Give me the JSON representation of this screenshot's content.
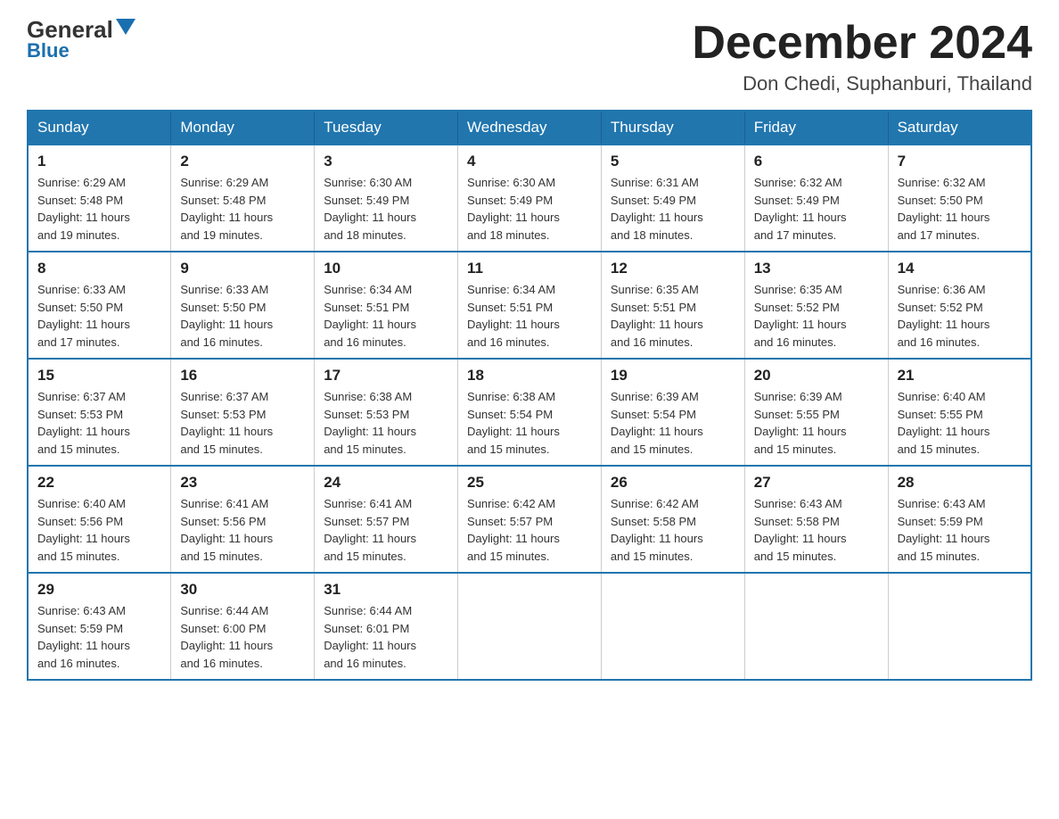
{
  "logo": {
    "general": "General",
    "triangle_char": "▲",
    "blue": "Blue"
  },
  "title": "December 2024",
  "subtitle": "Don Chedi, Suphanburi, Thailand",
  "days_of_week": [
    "Sunday",
    "Monday",
    "Tuesday",
    "Wednesday",
    "Thursday",
    "Friday",
    "Saturday"
  ],
  "weeks": [
    [
      {
        "day": 1,
        "sunrise": "6:29 AM",
        "sunset": "5:48 PM",
        "daylight": "11 hours and 19 minutes."
      },
      {
        "day": 2,
        "sunrise": "6:29 AM",
        "sunset": "5:48 PM",
        "daylight": "11 hours and 19 minutes."
      },
      {
        "day": 3,
        "sunrise": "6:30 AM",
        "sunset": "5:49 PM",
        "daylight": "11 hours and 18 minutes."
      },
      {
        "day": 4,
        "sunrise": "6:30 AM",
        "sunset": "5:49 PM",
        "daylight": "11 hours and 18 minutes."
      },
      {
        "day": 5,
        "sunrise": "6:31 AM",
        "sunset": "5:49 PM",
        "daylight": "11 hours and 18 minutes."
      },
      {
        "day": 6,
        "sunrise": "6:32 AM",
        "sunset": "5:49 PM",
        "daylight": "11 hours and 17 minutes."
      },
      {
        "day": 7,
        "sunrise": "6:32 AM",
        "sunset": "5:50 PM",
        "daylight": "11 hours and 17 minutes."
      }
    ],
    [
      {
        "day": 8,
        "sunrise": "6:33 AM",
        "sunset": "5:50 PM",
        "daylight": "11 hours and 17 minutes."
      },
      {
        "day": 9,
        "sunrise": "6:33 AM",
        "sunset": "5:50 PM",
        "daylight": "11 hours and 16 minutes."
      },
      {
        "day": 10,
        "sunrise": "6:34 AM",
        "sunset": "5:51 PM",
        "daylight": "11 hours and 16 minutes."
      },
      {
        "day": 11,
        "sunrise": "6:34 AM",
        "sunset": "5:51 PM",
        "daylight": "11 hours and 16 minutes."
      },
      {
        "day": 12,
        "sunrise": "6:35 AM",
        "sunset": "5:51 PM",
        "daylight": "11 hours and 16 minutes."
      },
      {
        "day": 13,
        "sunrise": "6:35 AM",
        "sunset": "5:52 PM",
        "daylight": "11 hours and 16 minutes."
      },
      {
        "day": 14,
        "sunrise": "6:36 AM",
        "sunset": "5:52 PM",
        "daylight": "11 hours and 16 minutes."
      }
    ],
    [
      {
        "day": 15,
        "sunrise": "6:37 AM",
        "sunset": "5:53 PM",
        "daylight": "11 hours and 15 minutes."
      },
      {
        "day": 16,
        "sunrise": "6:37 AM",
        "sunset": "5:53 PM",
        "daylight": "11 hours and 15 minutes."
      },
      {
        "day": 17,
        "sunrise": "6:38 AM",
        "sunset": "5:53 PM",
        "daylight": "11 hours and 15 minutes."
      },
      {
        "day": 18,
        "sunrise": "6:38 AM",
        "sunset": "5:54 PM",
        "daylight": "11 hours and 15 minutes."
      },
      {
        "day": 19,
        "sunrise": "6:39 AM",
        "sunset": "5:54 PM",
        "daylight": "11 hours and 15 minutes."
      },
      {
        "day": 20,
        "sunrise": "6:39 AM",
        "sunset": "5:55 PM",
        "daylight": "11 hours and 15 minutes."
      },
      {
        "day": 21,
        "sunrise": "6:40 AM",
        "sunset": "5:55 PM",
        "daylight": "11 hours and 15 minutes."
      }
    ],
    [
      {
        "day": 22,
        "sunrise": "6:40 AM",
        "sunset": "5:56 PM",
        "daylight": "11 hours and 15 minutes."
      },
      {
        "day": 23,
        "sunrise": "6:41 AM",
        "sunset": "5:56 PM",
        "daylight": "11 hours and 15 minutes."
      },
      {
        "day": 24,
        "sunrise": "6:41 AM",
        "sunset": "5:57 PM",
        "daylight": "11 hours and 15 minutes."
      },
      {
        "day": 25,
        "sunrise": "6:42 AM",
        "sunset": "5:57 PM",
        "daylight": "11 hours and 15 minutes."
      },
      {
        "day": 26,
        "sunrise": "6:42 AM",
        "sunset": "5:58 PM",
        "daylight": "11 hours and 15 minutes."
      },
      {
        "day": 27,
        "sunrise": "6:43 AM",
        "sunset": "5:58 PM",
        "daylight": "11 hours and 15 minutes."
      },
      {
        "day": 28,
        "sunrise": "6:43 AM",
        "sunset": "5:59 PM",
        "daylight": "11 hours and 15 minutes."
      }
    ],
    [
      {
        "day": 29,
        "sunrise": "6:43 AM",
        "sunset": "5:59 PM",
        "daylight": "11 hours and 16 minutes."
      },
      {
        "day": 30,
        "sunrise": "6:44 AM",
        "sunset": "6:00 PM",
        "daylight": "11 hours and 16 minutes."
      },
      {
        "day": 31,
        "sunrise": "6:44 AM",
        "sunset": "6:01 PM",
        "daylight": "11 hours and 16 minutes."
      },
      null,
      null,
      null,
      null
    ]
  ],
  "labels": {
    "sunrise": "Sunrise:",
    "sunset": "Sunset:",
    "daylight": "Daylight:"
  }
}
